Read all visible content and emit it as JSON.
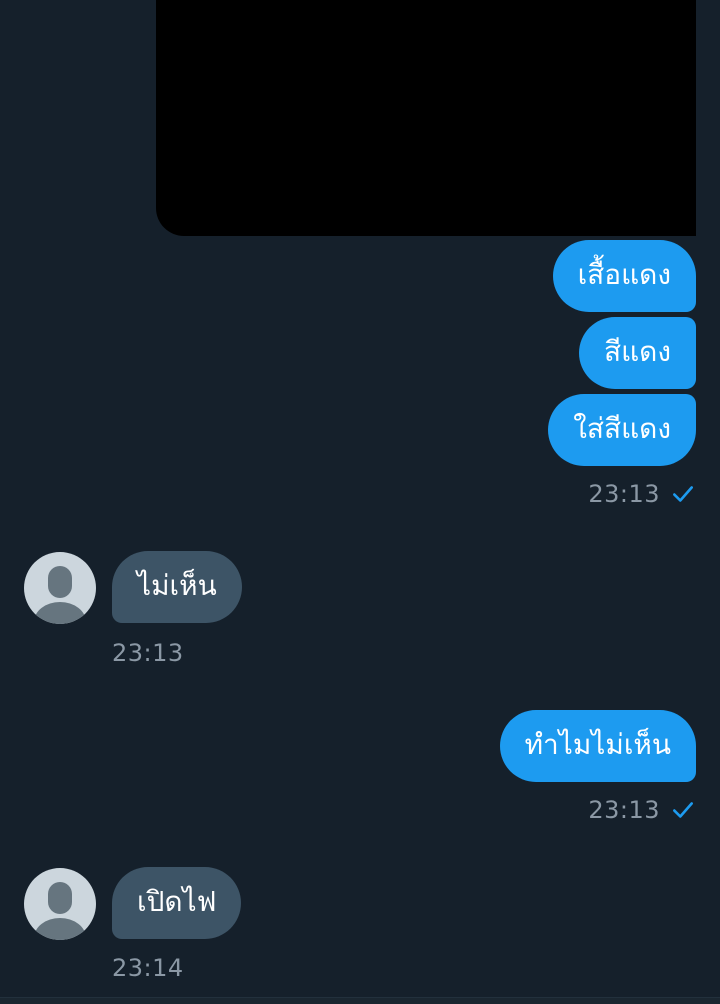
{
  "conversation": {
    "messages": [
      {
        "direction": "out",
        "text": "เสื้อแดง"
      },
      {
        "direction": "out",
        "text": "สีแดง"
      },
      {
        "direction": "out",
        "text": "ใส่สีแดง"
      },
      {
        "direction": "in",
        "text": "ไม่เห็น"
      },
      {
        "direction": "out",
        "text": "ทำไมไม่เห็น"
      },
      {
        "direction": "in",
        "text": "เปิดไฟ"
      }
    ],
    "timestamps": {
      "group1": "23:13",
      "reply1": "23:13",
      "group2": "23:13",
      "reply2": "23:14"
    }
  },
  "colors": {
    "background": "#15202b",
    "outgoing_bubble": "#1d9bf0",
    "incoming_bubble": "#3d5466",
    "timestamp": "#8b98a5"
  },
  "icons": {
    "read_receipt": "checkmark-icon",
    "avatar": "default-avatar-icon"
  }
}
